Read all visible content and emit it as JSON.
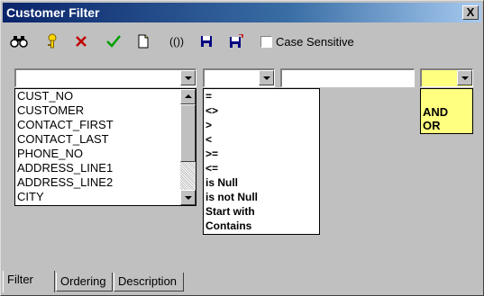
{
  "window": {
    "title": "Customer Filter",
    "close_label": "X"
  },
  "toolbar": {
    "buttons": [
      {
        "name": "binoculars-icon"
      },
      {
        "name": "key-icon"
      },
      {
        "name": "delete-icon"
      },
      {
        "name": "checkmark-icon"
      },
      {
        "name": "new-page-icon"
      },
      {
        "name": "parentheses-icon",
        "label": "(())"
      },
      {
        "name": "save-icon"
      },
      {
        "name": "save-as-icon"
      }
    ],
    "case_sensitive_label": "Case Sensitive",
    "case_sensitive_checked": false
  },
  "filter": {
    "field_value": "",
    "operator_value": "",
    "criteria_value": "",
    "logic_value": "",
    "fields": [
      "CUST_NO",
      "CUSTOMER",
      "CONTACT_FIRST",
      "CONTACT_LAST",
      "PHONE_NO",
      "ADDRESS_LINE1",
      "ADDRESS_LINE2",
      "CITY"
    ],
    "operators": [
      "=",
      "<>",
      ">",
      "<",
      ">=",
      "<=",
      "is Null",
      "is not Null",
      "Start with",
      "Contains"
    ],
    "logic": [
      "AND",
      "OR"
    ]
  },
  "tabs": [
    {
      "label": "Filter",
      "active": true
    },
    {
      "label": "Ordering",
      "active": false
    },
    {
      "label": "Description",
      "active": false
    }
  ],
  "colors": {
    "logic_bg": "#ffff80",
    "titlebar": "#0a246a"
  }
}
